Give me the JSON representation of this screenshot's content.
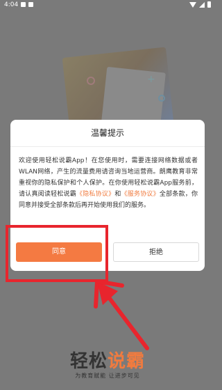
{
  "status_bar": {
    "time": "4:04"
  },
  "dialog": {
    "title": "温馨提示",
    "body_part1": "欢迎使用轻松说霸App！在您使用时，需要连接网络数据或者WLAN网络，产生的流量费用请咨询当地运营商。朗鹰教育非常重视你的隐私保护和个人保护。在你使用轻松说霸App服务前，请认真阅读轻松说霸",
    "privacy_link": "《隐私协议》",
    "and": "和",
    "service_link": "《服务协议》",
    "body_part2": "全部条款，你同意并接受全部条款后再开始使用我们的服务。",
    "agree_label": "同意",
    "refuse_label": "拒绝"
  },
  "logo": {
    "part1": "轻松",
    "part2": "说霸"
  },
  "slogan": "为教育赋能  让进步可见",
  "colors": {
    "accent": "#f47a42",
    "annotation": "#e8252d"
  }
}
